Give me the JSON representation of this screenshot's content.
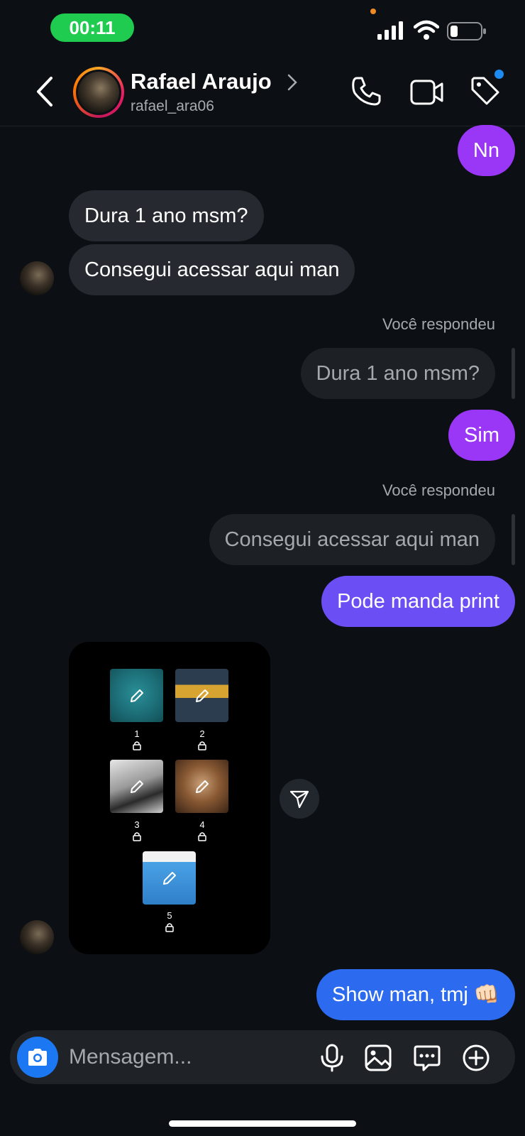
{
  "status_bar": {
    "time": "00:11"
  },
  "header": {
    "name": "Rafael Araujo",
    "username": "rafael_ara06"
  },
  "messages": [
    {
      "side": "sent",
      "text": "Nn"
    },
    {
      "side": "received",
      "text": "Dura 1 ano msm?"
    },
    {
      "side": "received",
      "text": "Consegui acessar aqui man"
    },
    {
      "side": "sent",
      "reply_label": "Você respondeu",
      "reply_quote": "Dura 1 ano msm?",
      "text": "Sim"
    },
    {
      "side": "sent",
      "reply_label": "Você respondeu",
      "reply_quote": "Consegui acessar aqui man",
      "text": "Pode manda print"
    },
    {
      "side": "sent",
      "text": "Show man, tmj 👊🏻"
    }
  ],
  "shared_post": {
    "items": [
      {
        "number": "1"
      },
      {
        "number": "2"
      },
      {
        "number": "3"
      },
      {
        "number": "4"
      },
      {
        "number": "5"
      }
    ]
  },
  "composer": {
    "placeholder": "Mensagem..."
  },
  "colors": {
    "background": "#0c1014",
    "sent_purple": "#9a36f5",
    "sent_violet": "#6c4ef5",
    "sent_blue": "#2c6af0",
    "received_gray": "#262a30",
    "camera_blue": "#1c78f2"
  }
}
